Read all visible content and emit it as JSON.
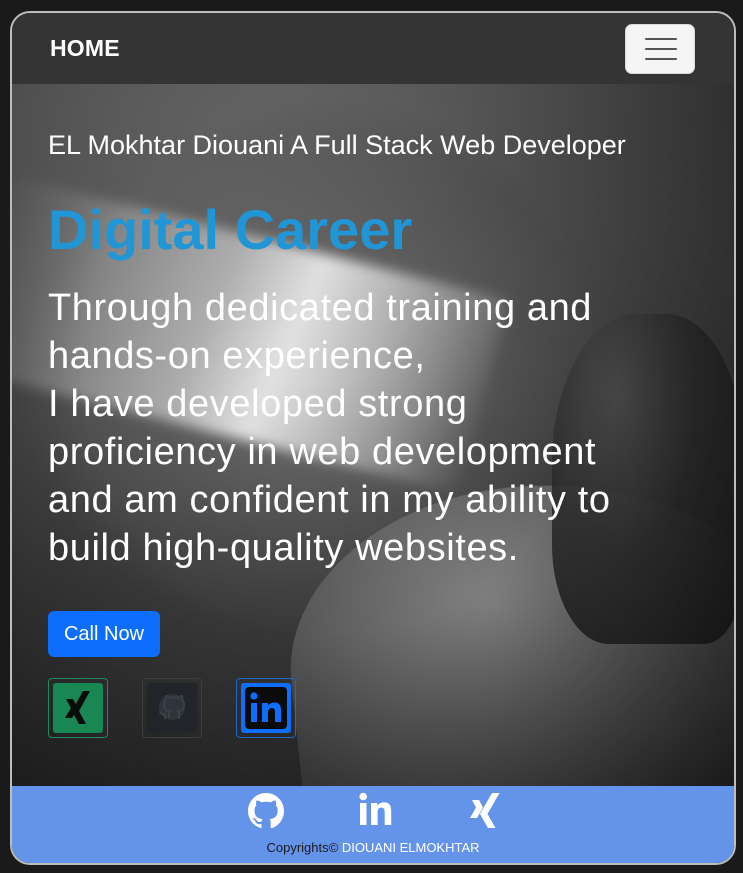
{
  "navbar": {
    "brand": "HOME",
    "toggler_icon": "hamburger-menu-icon"
  },
  "hero": {
    "subtitle": "EL Mokhtar Diouani A Full Stack Web Developer",
    "headline": "Digital Career",
    "description_lines": [
      "Through dedicated training and",
      "hands-on experience,",
      "I have developed strong",
      "proficiency in web development",
      "and am confident in my ability to",
      "build high-quality websites."
    ],
    "cta_label": "Call Now",
    "social_links": [
      {
        "icon": "xing-icon",
        "color": "#198754"
      },
      {
        "icon": "github-icon",
        "color": "#212529"
      },
      {
        "icon": "linkedin-icon",
        "color": "#0d6efd"
      }
    ]
  },
  "footer": {
    "icons": [
      "github-icon",
      "linkedin-icon",
      "xing-icon"
    ],
    "copyright_prefix": "Copyrights©",
    "copyright_owner": "DIOUANI ELMOKHTAR",
    "background": "#6493ea"
  },
  "colors": {
    "accent": "#2196d6",
    "primary_button": "#0d6efd",
    "navbar": "#343434"
  }
}
